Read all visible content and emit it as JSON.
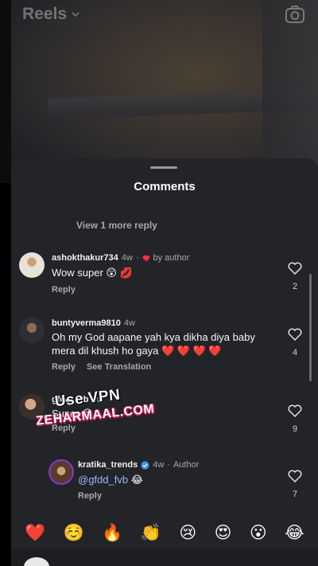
{
  "header": {
    "title": "Reels"
  },
  "sheet": {
    "title": "Comments",
    "view_more": "View 1 more reply"
  },
  "comments": [
    {
      "username": "ashokthakur734",
      "time": "4w",
      "by_author": "by author",
      "text": "Wow super 😲 💋",
      "reply": "Reply",
      "likes": "2"
    },
    {
      "username": "buntyverma9810",
      "time": "4w",
      "text": "Oh my God aapane yah kya dikha diya baby mera dil khush ho gaya ❤️ ❤️ ❤️ ❤️",
      "reply": "Reply",
      "translate": "See Translation",
      "likes": "4"
    },
    {
      "username": "gfdd_fvb",
      "time": "4w",
      "text": "Super 😊",
      "reply": "Reply",
      "likes": "9"
    }
  ],
  "reply": {
    "username": "kratika_trends",
    "time": "4w",
    "author_tag": "Author",
    "mention": "@gfdd_fvb",
    "emoji": "😂",
    "reply": "Reply",
    "likes": "7"
  },
  "watermark": {
    "line1": "Use VPN",
    "line2": "ZEHARMAAL.COM"
  },
  "emoji_bar": [
    "❤️",
    "☺️",
    "🔥",
    "👏",
    "😢",
    "😍",
    "😮",
    "😂"
  ],
  "colors": {
    "sheet": "#232428",
    "heart_red": "#ff3040",
    "mention": "#9cb7ff",
    "verified": "#3897f0"
  }
}
